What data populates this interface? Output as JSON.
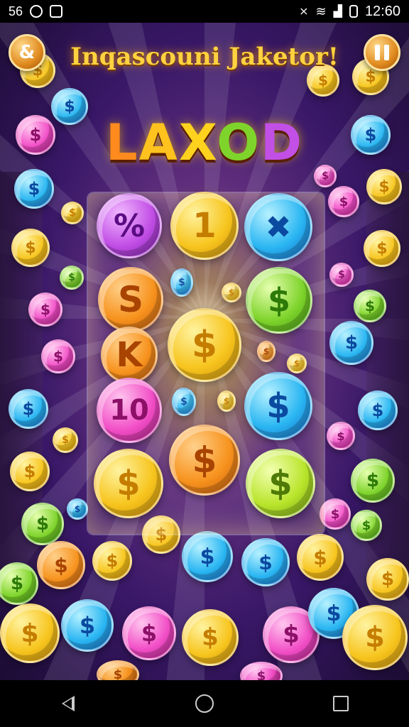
{
  "status_bar": {
    "left_text": "56",
    "icons_left": [
      "circle-logo-icon",
      "app-badge-icon"
    ],
    "icons_right": [
      "mute-icon",
      "wifi-icon",
      "signal-icon",
      "battery-icon"
    ],
    "time": "12:60"
  },
  "header": {
    "title": "Inqascouni Jaketor!",
    "logo_letters": [
      "L",
      "A",
      "X",
      "O",
      "D"
    ],
    "menu_button_symbol": "&",
    "pause_button": "pause"
  },
  "reels": {
    "columns": 3,
    "rows": 5,
    "symbols": [
      "%",
      "1",
      "✖",
      "S",
      "$",
      "$",
      "K",
      "$",
      "$",
      "10",
      "$",
      "$",
      "$",
      "$",
      "$"
    ]
  },
  "coin_symbol": "$",
  "colors": {
    "title": "#ffd23f",
    "background": "#1c0c33",
    "accent_gold": "#f7c51e"
  },
  "nav": {
    "back": "back-icon",
    "home": "home-icon",
    "recents": "recents-icon"
  }
}
